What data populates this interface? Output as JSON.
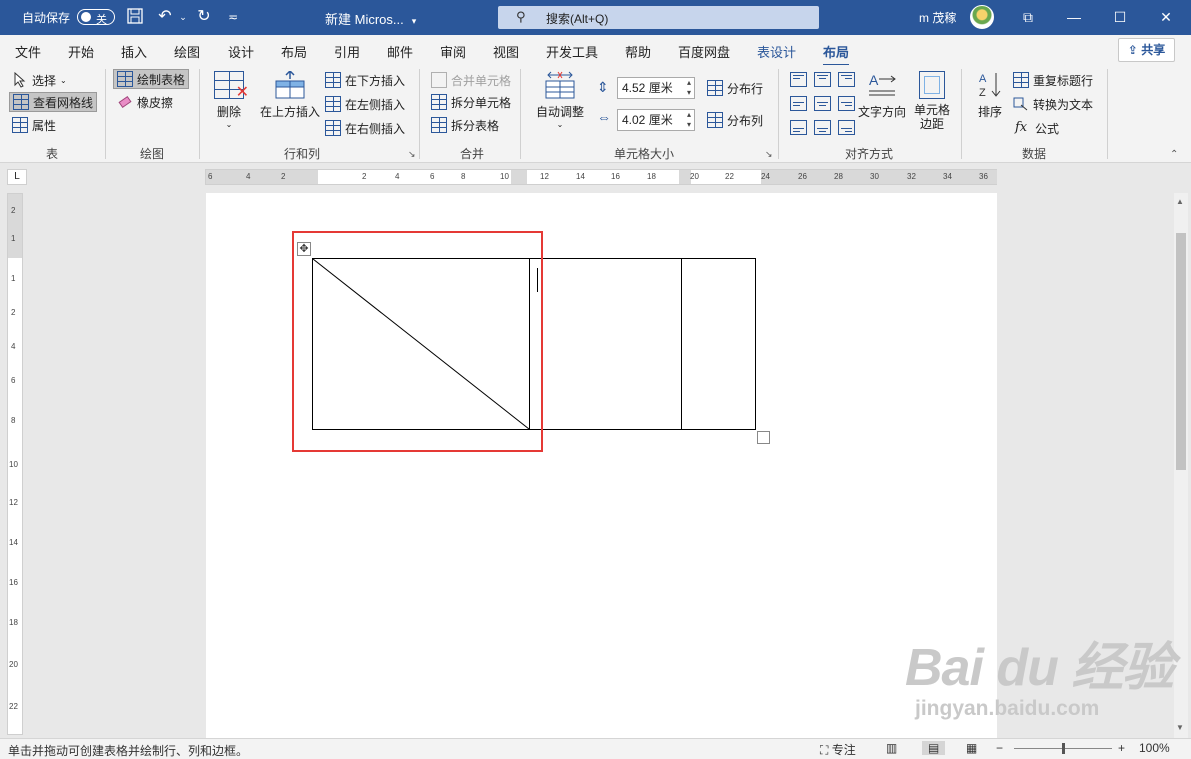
{
  "titlebar": {
    "autosave_label": "自动保存",
    "autosave_state": "关",
    "doc_title": "新建 Micros...",
    "search_placeholder": "搜索(Alt+Q)",
    "user_name": "m 茂稼",
    "share_label": "共享"
  },
  "tabs": [
    "文件",
    "开始",
    "插入",
    "绘图",
    "设计",
    "布局",
    "引用",
    "邮件",
    "审阅",
    "视图",
    "开发工具",
    "帮助",
    "百度网盘",
    "表设计",
    "布局"
  ],
  "active_tab": "布局",
  "ribbon": {
    "table_group": {
      "label": "表",
      "select": "选择",
      "view_gridlines": "查看网格线",
      "properties": "属性"
    },
    "draw_group": {
      "label": "绘图",
      "draw_table": "绘制表格",
      "eraser": "橡皮擦"
    },
    "rows_cols_group": {
      "label": "行和列",
      "delete": "删除",
      "insert_above": "在上方插入",
      "insert_below": "在下方插入",
      "insert_left": "在左侧插入",
      "insert_right": "在右侧插入"
    },
    "merge_group": {
      "label": "合并",
      "merge_cells": "合并单元格",
      "split_cells": "拆分单元格",
      "split_table": "拆分表格"
    },
    "cell_size_group": {
      "label": "单元格大小",
      "autofit": "自动调整",
      "height": "4.52 厘米",
      "width": "4.02 厘米",
      "distribute_rows": "分布行",
      "distribute_cols": "分布列"
    },
    "alignment_group": {
      "label": "对齐方式",
      "text_direction": "文字方向",
      "cell_margins_1": "单元格",
      "cell_margins_2": "边距"
    },
    "data_group": {
      "label": "数据",
      "sort": "排序",
      "repeat_header": "重复标题行",
      "convert_to_text": "转换为文本",
      "formula": "公式",
      "formula_symbol": "fx"
    }
  },
  "ruler_h": [
    "6",
    "4",
    "2",
    "2",
    "4",
    "6",
    "8",
    "10",
    "12",
    "14",
    "16",
    "18",
    "20",
    "22",
    "24",
    "26",
    "28",
    "30",
    "32",
    "34",
    "36"
  ],
  "ruler_v": [
    "2",
    "1",
    "1",
    "2",
    "4",
    "6",
    "8",
    "10",
    "12",
    "14",
    "16",
    "18",
    "20",
    "22"
  ],
  "watermark": {
    "main": "Bai du 经验",
    "sub": "jingyan.baidu.com"
  },
  "statusbar": {
    "message": "单击并拖动可创建表格并绘制行、列和边框。",
    "focus": "专注",
    "zoom": "100%",
    "zoom_level": 0.5
  }
}
